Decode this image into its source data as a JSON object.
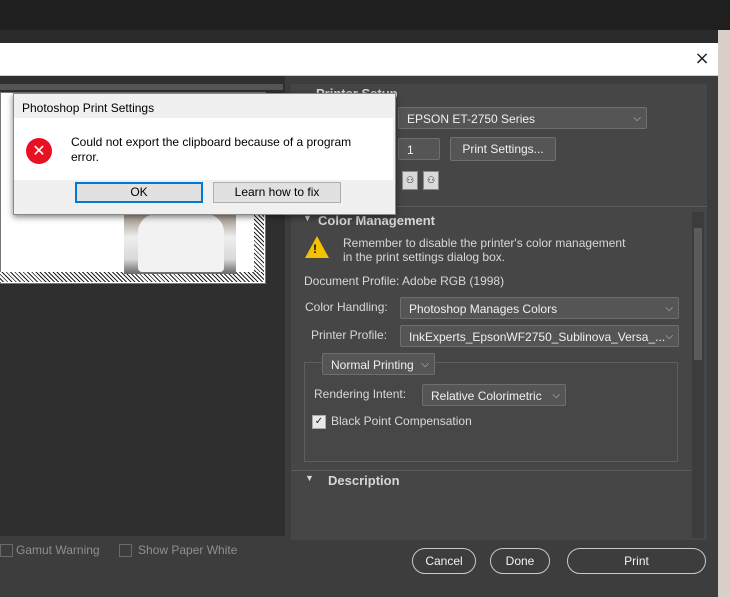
{
  "window": {
    "close_glyph": "×"
  },
  "printer_setup": {
    "header": "Printer Setup",
    "printer": "EPSON ET-2750 Series",
    "copies": "1",
    "print_settings_button": "Print Settings..."
  },
  "color_management": {
    "header": "Color Management",
    "warning": "Remember to disable the printer's color management in the print settings dialog box.",
    "document_profile": "Document Profile: Adobe RGB (1998)",
    "color_handling_label": "Color Handling:",
    "color_handling_value": "Photoshop Manages Colors",
    "printer_profile_label": "Printer Profile:",
    "printer_profile_value": "InkExperts_EpsonWF2750_Sublinova_Versa_...",
    "normal_printing": "Normal Printing",
    "rendering_intent_label": "Rendering Intent:",
    "rendering_intent_value": "Relative Colorimetric",
    "black_point_label": "Black Point Compensation",
    "black_point_checked": true
  },
  "description": {
    "header": "Description"
  },
  "preview_options": {
    "gamut_warning": "Gamut Warning",
    "show_paper_white": "Show Paper White"
  },
  "buttons": {
    "cancel": "Cancel",
    "done": "Done",
    "print": "Print"
  },
  "dialog": {
    "title": "Photoshop Print Settings",
    "message": "Could not export the clipboard because of a program error.",
    "ok": "OK",
    "learn": "Learn how to fix"
  },
  "icons": [
    "error-icon",
    "warning-icon",
    "portrait-orientation-icon",
    "landscape-orientation-icon",
    "checkbox-checked-icon",
    "chevron-down-icon",
    "close-icon"
  ]
}
